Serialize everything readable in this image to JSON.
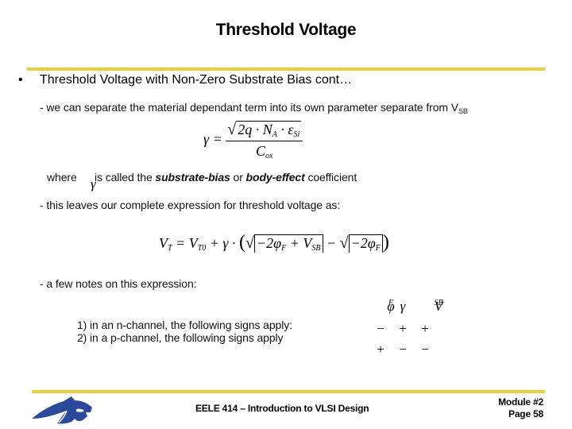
{
  "slide": {
    "title": "Threshold Voltage",
    "bullet_char": "•",
    "bullet_heading": "Threshold Voltage with Non-Zero Substrate Bias cont…",
    "line1_prefix": "- we can separate the material dependant term into its own parameter separate from V",
    "line1_sub": "SB",
    "gamma_eq": {
      "lhs": "γ =",
      "numerator": "2q · N",
      "na_sub": "A",
      "mid": " · ε",
      "eps_sub": "Si",
      "denominator": "C",
      "cox_sub": "ox"
    },
    "where_text": "where",
    "gamma_symbol": "γ",
    "where_rest_1": "is called the ",
    "where_bold_1": "substrate-bias",
    "where_rest_2": " or ",
    "where_bold_2": "body-effect",
    "where_rest_3": " coefficient",
    "line2": "- this leaves our complete expression for threshold voltage as:",
    "vt_eq": {
      "vt": "V",
      "vt_sub": "T",
      "eq": " = V",
      "vt0_sub": "T0",
      "plus_gamma": " + γ · ",
      "term1": "−2φ",
      "f_sub": "F",
      "plus_vsb": " + V",
      "sb_sub": "SB",
      "minus": " − ",
      "term2": "−2φ",
      "f_sub2": "F"
    },
    "line3": "- a few notes on this expression:",
    "note1": "1) in an n-channel, the following signs apply:",
    "note2": "2) in a p-channel, the following signs apply",
    "sign_table": {
      "headers": [
        "φ",
        "γ",
        "V"
      ],
      "header_subs": [
        "F",
        "",
        "SB"
      ],
      "n_channel": [
        "−",
        "+",
        "+"
      ],
      "p_channel": [
        "+",
        "−",
        "−"
      ]
    }
  },
  "footer": {
    "course": "EELE 414 – Introduction to VLSI Design",
    "module": "Module #2",
    "page": "Page 58",
    "logo": "bobcat-logo"
  },
  "colors": {
    "rule": "#eccd3a",
    "logo": "#2b4a9a"
  }
}
